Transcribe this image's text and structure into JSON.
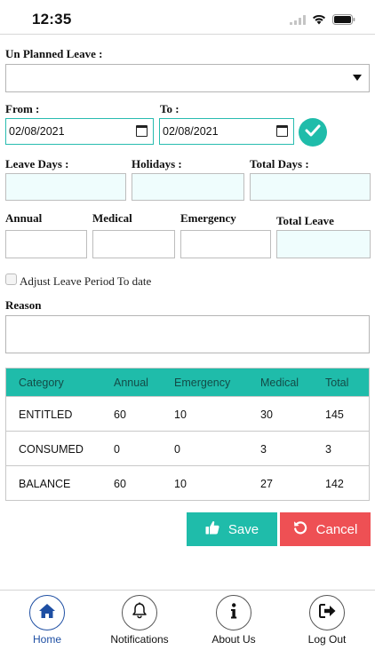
{
  "status_bar": {
    "time": "12:35"
  },
  "form": {
    "leave_type_label": "Un Planned Leave :",
    "leave_type_value": "",
    "from_label": "From :",
    "from_value": "02/08/2021",
    "to_label": "To :",
    "to_value": "02/08/2021",
    "leave_days_label": "Leave Days :",
    "holidays_label": "Holidays :",
    "total_days_label": "Total Days :",
    "annual_label": "Annual",
    "medical_label": "Medical",
    "emergency_label": "Emergency",
    "total_leave_label": "Total Leave",
    "adjust_label": "Adjust Leave Period To date",
    "adjust_checked": false,
    "reason_label": "Reason"
  },
  "table": {
    "headers": [
      "Category",
      "Annual",
      "Emergency",
      "Medical",
      "Total"
    ],
    "rows": [
      [
        "ENTITLED",
        "60",
        "10",
        "30",
        "145"
      ],
      [
        "CONSUMED",
        "0",
        "0",
        "3",
        "3"
      ],
      [
        "BALANCE",
        "60",
        "10",
        "27",
        "142"
      ]
    ]
  },
  "actions": {
    "save_label": "Save",
    "cancel_label": "Cancel"
  },
  "nav": {
    "items": [
      {
        "label": "Home",
        "icon": "home-icon",
        "active": true
      },
      {
        "label": "Notifications",
        "icon": "bell-icon",
        "active": false
      },
      {
        "label": "About Us",
        "icon": "info-icon",
        "active": false
      },
      {
        "label": "Log Out",
        "icon": "logout-icon",
        "active": false
      }
    ]
  },
  "colors": {
    "accent": "#1fbcaa",
    "danger": "#ee5054",
    "active_nav": "#1e4fa3",
    "field_tint": "#effdfd"
  }
}
